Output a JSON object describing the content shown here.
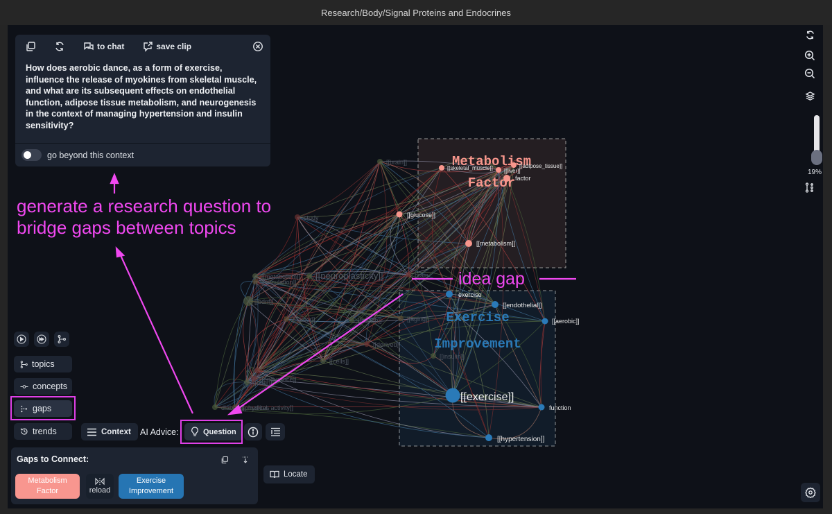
{
  "window": {
    "title": "Research/Body/Signal Proteins and Endocrines"
  },
  "question_panel": {
    "toolbar": {
      "copy_icon": "copy-icon",
      "refresh_icon": "refresh-icon",
      "to_chat_label": "to chat",
      "save_clip_label": "save clip",
      "close_icon": "close-circle-icon"
    },
    "question": "How does aerobic dance, as a form of exercise, influence the release of myokines from skeletal muscle, and what are its subsequent effects on endothelial function, adipose tissue metabolism, and neurogenesis in the context of managing hypertension and insulin sensitivity?",
    "toggle": {
      "label": "go beyond this context",
      "on": false
    }
  },
  "annotations": {
    "main": "generate a research question to bridge gaps between topics",
    "line1": "generate a research question to",
    "line2": "bridge gaps between topics",
    "idea_gap": "idea gap",
    "color": "#f048f0"
  },
  "graph": {
    "clusters": [
      {
        "title_line1": "Metabolism",
        "title_line2": "Factor",
        "color": "#f8968c"
      },
      {
        "title_line1": "Exercise",
        "title_line2": "Improvement",
        "color": "#2a7ab8"
      }
    ],
    "nodes_metabolism": [
      "[[skeletal_muscle]]",
      "[[liver]]",
      "[[adipose_tissue]]",
      "factor",
      "[[glucose]]",
      "[[metabolism]]"
    ],
    "nodes_exercise": [
      "exercise",
      "[[endothelial]]",
      "[[aerobic]]",
      "[[exercise]]",
      "function",
      "[[hypertension]]"
    ],
    "nodes_faded": [
      "[[brain]]",
      "study",
      "[[metabolism]]",
      "[[circulation]]",
      "[[neuroplasticity]]",
      "brain",
      "[[bdnf]]",
      "[[factor]]",
      "[[health]]",
      "[[derived]]",
      "[[cells]]",
      "[[aging]]",
      "[[insulin]]",
      "[[endurance]]",
      "[[brain]]",
      "[[physical_activity]]",
      "diabetes_mellitus",
      "ai"
    ]
  },
  "left_controls": {
    "play_icon": "play-icon",
    "fast_forward_icon": "fast-forward-icon",
    "graph_icon": "graph-branch-icon",
    "nav": [
      {
        "label": "topics",
        "icon": "topics-icon",
        "active": false
      },
      {
        "label": "concepts",
        "icon": "concepts-icon",
        "active": false
      },
      {
        "label": "gaps",
        "icon": "gaps-icon",
        "active": true
      },
      {
        "label": "trends",
        "icon": "history-icon",
        "active": false
      }
    ]
  },
  "bottom_bar": {
    "context_label": "Context",
    "ai_advice_label": "AI Advice:",
    "question_label": "Question",
    "info_icon": "info-icon",
    "list_icon": "list-icon"
  },
  "gaps_panel": {
    "title": "Gaps to Connect:",
    "gap_a": {
      "line1": "Metabolism",
      "line2": "Factor",
      "color": "#f8968f"
    },
    "reload_label": "reload",
    "gap_b": {
      "line1": "Exercise",
      "line2": "Improvement",
      "color": "#2675b3"
    }
  },
  "locate_label": "Locate",
  "right_tools": {
    "zoom_level": "19%",
    "zoom_fraction": 0.19
  }
}
